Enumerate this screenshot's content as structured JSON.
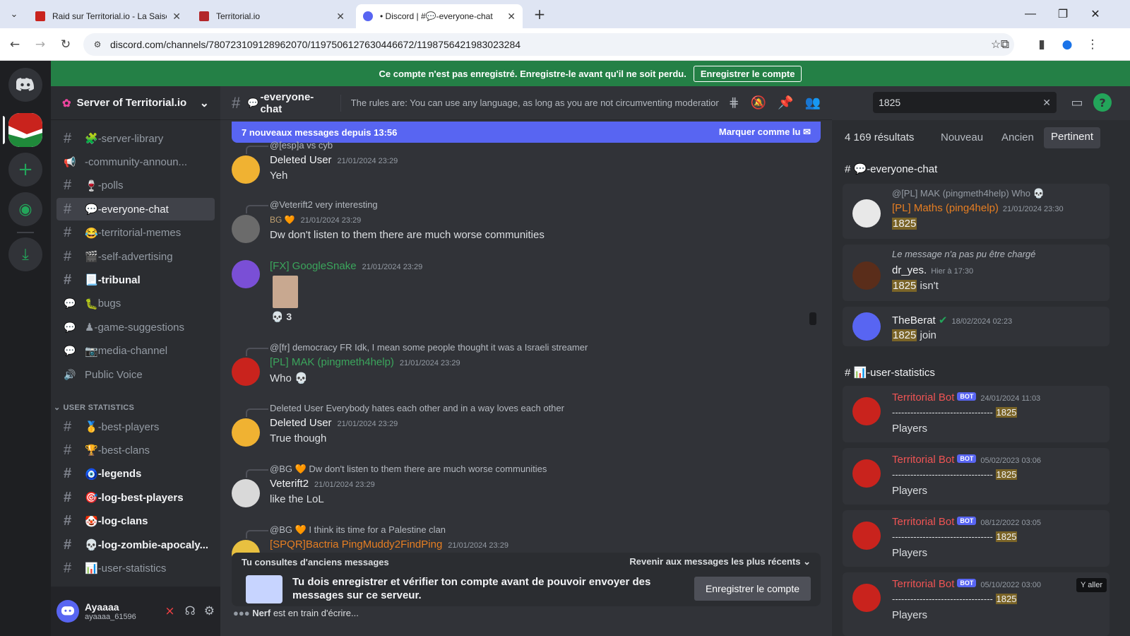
{
  "browser": {
    "tabs": [
      {
        "title": "Raid sur Territorial.io - La Saison",
        "fav": "#c9231d"
      },
      {
        "title": "Territorial.io",
        "fav": "#b3262a"
      },
      {
        "title": "• Discord | #💬-everyone-chat",
        "fav": "#5865f2"
      }
    ],
    "url": "discord.com/channels/780723109128962070/1197506127630446672/1198756421983023284"
  },
  "banner": {
    "text": "Ce compte n'est pas enregistré. Enregistre-le avant qu'il ne soit perdu.",
    "button": "Enregistrer le compte"
  },
  "server": {
    "name": "Server of Territorial.io"
  },
  "channels": [
    {
      "label": "-server-library",
      "icon": "🧩",
      "type": "text"
    },
    {
      "label": "-community-announ...",
      "icon": "📢",
      "type": "announce"
    },
    {
      "label": "-polls",
      "icon": "🍷",
      "type": "text"
    },
    {
      "label": "-everyone-chat",
      "icon": "💬",
      "type": "text"
    },
    {
      "label": "-territorial-memes",
      "icon": "😂",
      "type": "text"
    },
    {
      "label": "-self-advertising",
      "icon": "🎬",
      "type": "text"
    },
    {
      "label": "-tribunal",
      "icon": "📃",
      "type": "text"
    },
    {
      "label": "bugs",
      "icon": "🐛",
      "type": "forum"
    },
    {
      "label": "-game-suggestions",
      "icon": "♟",
      "type": "forum"
    },
    {
      "label": "media-channel",
      "icon": "📷",
      "type": "forum"
    },
    {
      "label": "Public Voice",
      "icon": "",
      "type": "voice"
    }
  ],
  "category": "USER STATISTICS",
  "stat_channels": [
    {
      "label": "-best-players",
      "icon": "🥇"
    },
    {
      "label": "-best-clans",
      "icon": "🏆"
    },
    {
      "label": "-legends",
      "icon": "🧿"
    },
    {
      "label": "-log-best-players",
      "icon": "🎯"
    },
    {
      "label": "-log-clans",
      "icon": "🤡"
    },
    {
      "label": "-log-zombie-apocaly...",
      "icon": "💀"
    },
    {
      "label": "-user-statistics",
      "icon": "📊"
    }
  ],
  "user": {
    "name": "Ayaaaa",
    "tag": "ayaaaa_61596"
  },
  "channel_header": {
    "name": "-everyone-chat",
    "icon": "💬",
    "topic": "The rules are: You can use any language, as long as you are not circumventing moderation with..."
  },
  "new_messages": {
    "text": "7 nouveaux messages depuis 13:56",
    "action": "Marquer comme lu"
  },
  "messages": [
    {
      "reply": "@[esp]a vs cyb",
      "name": "Deleted User",
      "time": "21/01/2024 23:29",
      "body": "Yeh"
    },
    {
      "reply": "@Veterift2 very interesting",
      "name": "BG 🧡",
      "time": "21/01/2024 23:29",
      "body": "Dw don't listen to them there are much worse communities"
    },
    {
      "name": "[FX] GoogleSnake",
      "time": "21/01/2024 23:29",
      "reaction": "💀 3"
    },
    {
      "reply": "@[fr] democracy FR Idk, I mean some people thought it was a Israeli streamer",
      "name": "[PL] MAK (pingmeth4help)",
      "time": "21/01/2024 23:29",
      "body": "Who 💀"
    },
    {
      "reply": "Deleted User Everybody hates each other and in a way loves each other",
      "name": "Deleted User",
      "time": "21/01/2024 23:29",
      "body": "True though"
    },
    {
      "reply": "@BG 🧡 Dw don't listen to them there are much worse communities",
      "name": "Veterift2",
      "time": "21/01/2024 23:29",
      "body": "like the LoL"
    },
    {
      "reply": "@BG 🧡 I think its time for a Palestine clan",
      "name": "[SPQR]Bactria PingMuddy2FindPing",
      "time": "21/01/2024 23:29"
    }
  ],
  "old_messages": {
    "text": "Tu consultes d'anciens messages",
    "action": "Revenir aux messages les plus récents"
  },
  "register": {
    "text": "Tu dois enregistrer et vérifier ton compte avant de pouvoir envoyer des messages sur ce serveur.",
    "button": "Enregistrer le compte"
  },
  "typing": {
    "user": "Nerf",
    "text": "est en train d'écrire..."
  },
  "search": {
    "query": "1825",
    "count": "4 169 résultats",
    "sort": [
      "Nouveau",
      "Ancien",
      "Pertinent"
    ],
    "group1": "-everyone-chat",
    "group2": "-user-statistics",
    "results1": [
      {
        "reply": "@[PL] MAK (pingmeth4help) Who 💀",
        "name": "[PL] Maths (ping4help)",
        "time": "21/01/2024 23:30",
        "hl": "1825",
        "rest": ""
      },
      {
        "reply": "Le message n'a pas pu être chargé",
        "name": "dr_yes.",
        "time": "Hier à 17:30",
        "hl": "1825",
        "rest": " isn't"
      },
      {
        "name": "TheBerat",
        "time": "18/02/2024 02:23",
        "hl": "1825",
        "rest": " join"
      }
    ],
    "results2": [
      {
        "name": "Territorial Bot",
        "time": "24/01/2024 11:03",
        "line": "---------------------------------",
        "hl": "1825",
        "rest": "Players"
      },
      {
        "name": "Territorial Bot",
        "time": "05/02/2023 03:06",
        "line": "---------------------------------",
        "hl": "1825",
        "rest": "Players"
      },
      {
        "name": "Territorial Bot",
        "time": "08/12/2022 03:05",
        "line": "---------------------------------",
        "hl": "1825",
        "rest": "Players"
      },
      {
        "name": "Territorial Bot",
        "time": "05/10/2022 03:00",
        "line": "---------------------------------",
        "hl": "1825",
        "rest": "Players"
      }
    ],
    "bot_label": "BOT",
    "goto": "Y aller"
  },
  "colors": {
    "blurple": "#5865f2",
    "green": "#248046",
    "mak": "#3ba55c",
    "maths": "#e67e22",
    "bot": "#f05454"
  }
}
